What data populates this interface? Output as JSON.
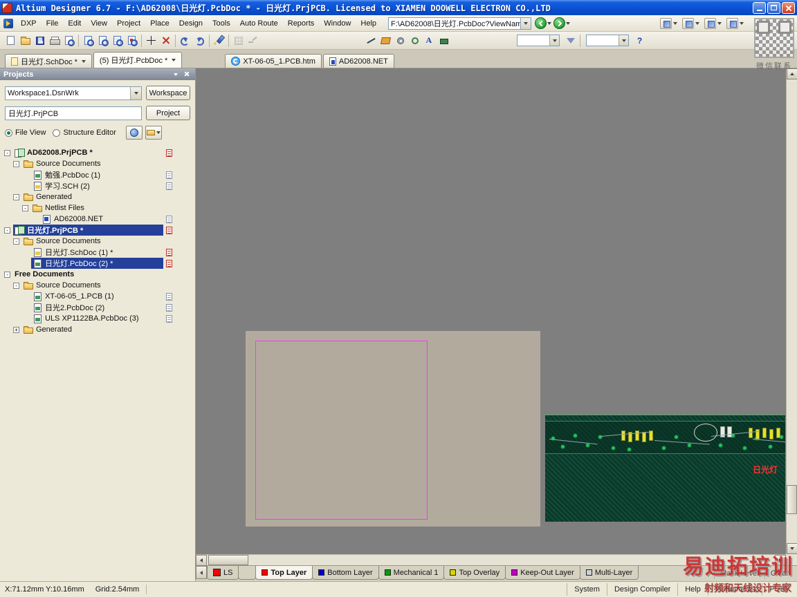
{
  "window": {
    "title": "Altium Designer 6.7 - F:\\AD62008\\日光灯.PcbDoc * - 日光灯.PrjPCB. Licensed to XIAMEN DOOWELL ELECTRON CO.,LTD"
  },
  "menubar": {
    "items": [
      "DXP",
      "File",
      "Edit",
      "View",
      "Project",
      "Place",
      "Design",
      "Tools",
      "Auto Route",
      "Reports",
      "Window",
      "Help"
    ],
    "address_value": "F:\\AD62008\\日光灯.PcbDoc?ViewNam"
  },
  "toolbar": {
    "icons": [
      {
        "name": "new-document",
        "glyph": "page",
        "enabled": true
      },
      {
        "name": "open-document",
        "glyph": "folder",
        "enabled": true
      },
      {
        "name": "save-document",
        "glyph": "floppy",
        "enabled": true
      },
      {
        "name": "print",
        "glyph": "printer",
        "enabled": true
      },
      {
        "name": "print-preview",
        "glyph": "preview",
        "enabled": true
      },
      {
        "name": "sep"
      },
      {
        "name": "zoom-fit-document",
        "glyph": "zoompage",
        "enabled": true
      },
      {
        "name": "zoom-fit-sheet",
        "glyph": "zoomsheet",
        "enabled": true
      },
      {
        "name": "zoom-area",
        "glyph": "zoomarea",
        "enabled": true
      },
      {
        "name": "zoom-selection",
        "glyph": "zoomsel",
        "enabled": true
      },
      {
        "name": "sep"
      },
      {
        "name": "cross-probe",
        "glyph": "cross",
        "enabled": true
      },
      {
        "name": "cut",
        "glyph": "cut",
        "enabled": true
      },
      {
        "name": "sep"
      },
      {
        "name": "undo",
        "glyph": "undo",
        "enabled": true
      },
      {
        "name": "redo",
        "glyph": "redo",
        "enabled": true
      },
      {
        "name": "sep"
      },
      {
        "name": "edit-pen",
        "glyph": "pen",
        "enabled": true
      },
      {
        "name": "sep"
      },
      {
        "name": "snap-grid",
        "glyph": "grid",
        "enabled": false
      },
      {
        "name": "interactive-routing",
        "glyph": "route",
        "enabled": false
      },
      {
        "name": "spacer1"
      },
      {
        "name": "place-line",
        "glyph": "line",
        "enabled": true
      },
      {
        "name": "place-polygon",
        "glyph": "poly",
        "enabled": true
      },
      {
        "name": "place-pad",
        "glyph": "pad",
        "enabled": true
      },
      {
        "name": "place-via",
        "glyph": "via",
        "enabled": true
      },
      {
        "name": "place-string",
        "glyph": "textA",
        "enabled": true
      },
      {
        "name": "place-component",
        "glyph": "comp",
        "enabled": true
      },
      {
        "name": "spacer2"
      },
      {
        "name": "combo"
      },
      {
        "name": "filter",
        "glyph": "funnel",
        "enabled": true
      },
      {
        "name": "sep"
      },
      {
        "name": "combo"
      },
      {
        "name": "help",
        "glyph": "help",
        "enabled": true
      }
    ]
  },
  "menu_right_tools": [
    {
      "name": "wiring-toolbar-button"
    },
    {
      "name": "utilities-toolbar-button"
    },
    {
      "name": "navigation-toolbar-button"
    },
    {
      "name": "filter-toolbar-button"
    }
  ],
  "doc_tabs": [
    {
      "label": "日光灯.SchDoc *",
      "icon": "sch",
      "dropdown": true,
      "active": false
    },
    {
      "label": "(5) 日光灯.PcbDoc *",
      "icon": "none",
      "dropdown": true,
      "active": true
    },
    {
      "label": "XT-06-05_1.PCB.htm",
      "icon": "ie",
      "dropdown": false,
      "active": false
    },
    {
      "label": "AD62008.NET",
      "icon": "net",
      "dropdown": false,
      "active": false
    }
  ],
  "projects_panel": {
    "title": "Projects",
    "workspace_value": "Workspace1.DsnWrk",
    "workspace_button": "Workspace",
    "project_value": "日光灯.PrjPCB",
    "project_button": "Project",
    "file_view_label": "File View",
    "structure_editor_label": "Structure Editor",
    "tree": [
      {
        "depth": 0,
        "icon": "prj",
        "label": "AD62008.PrjPCB *",
        "bold": true,
        "expand": "-",
        "page": "red"
      },
      {
        "depth": 1,
        "icon": "folder",
        "label": "Source Documents",
        "expand": "-"
      },
      {
        "depth": 2,
        "icon": "pcb",
        "label": "勉强.PcbDoc (1)",
        "page": "gray"
      },
      {
        "depth": 2,
        "icon": "sch",
        "label": "学习.SCH (2)",
        "page": "gray"
      },
      {
        "depth": 1,
        "icon": "folder",
        "label": "Generated",
        "expand": "-"
      },
      {
        "depth": 2,
        "icon": "folder",
        "label": "Netlist Files",
        "expand": "-"
      },
      {
        "depth": 3,
        "icon": "net",
        "label": "AD62008.NET",
        "page": "gray"
      },
      {
        "depth": 0,
        "icon": "prj",
        "label": "日光灯.PrjPCB *",
        "bold": true,
        "selected": true,
        "expand": "-",
        "page": "red"
      },
      {
        "depth": 1,
        "icon": "folder",
        "label": "Source Documents",
        "expand": "-"
      },
      {
        "depth": 2,
        "icon": "sch",
        "label": "日光灯.SchDoc (1) *",
        "page": "red"
      },
      {
        "depth": 2,
        "icon": "pcb",
        "label": "日光灯.PcbDoc (2) *",
        "selected": true,
        "page": "red"
      },
      {
        "depth": 0,
        "icon": "none",
        "label": "Free Documents",
        "bold": true,
        "expand": "-"
      },
      {
        "depth": 1,
        "icon": "folder",
        "label": "Source Documents",
        "expand": "-"
      },
      {
        "depth": 2,
        "icon": "pcb",
        "label": "XT-06-05_1.PCB (1)",
        "page": "gray"
      },
      {
        "depth": 2,
        "icon": "pcb",
        "label": "日光2.PcbDoc (2)",
        "page": "gray"
      },
      {
        "depth": 2,
        "icon": "pcb",
        "label": "ULS XP1122BA.PcbDoc (3)",
        "page": "gray"
      },
      {
        "depth": 1,
        "icon": "folder",
        "label": "Generated",
        "expand": "+"
      }
    ]
  },
  "canvas": {
    "board_label": "日光灯"
  },
  "layer_bar": {
    "ls_label": "LS",
    "tabs": [
      {
        "label": "Top Layer",
        "color": "#ff0000",
        "active": true
      },
      {
        "label": "Bottom Layer",
        "color": "#0000c8",
        "active": false
      },
      {
        "label": "Mechanical 1",
        "color": "#00a000",
        "active": false
      },
      {
        "label": "Top Overlay",
        "color": "#d8d800",
        "active": false
      },
      {
        "label": "Keep-Out Layer",
        "color": "#c000c0",
        "active": false
      },
      {
        "label": "Multi-Layer",
        "color": "#d0d0d0",
        "active": false
      }
    ],
    "mask_level_label": "Mask Level",
    "clear_label": "Clear"
  },
  "status_bar": {
    "coords": "X:71.12mm Y:10.16mm",
    "grid": "Grid:2.54mm",
    "panels": [
      "System",
      "Design Compiler",
      "Help",
      "Instruments",
      "PCB"
    ]
  },
  "watermarks": {
    "wechat": "微信联系",
    "brand": "易迪拓培训",
    "slogan": "射频和天线设计专家"
  }
}
